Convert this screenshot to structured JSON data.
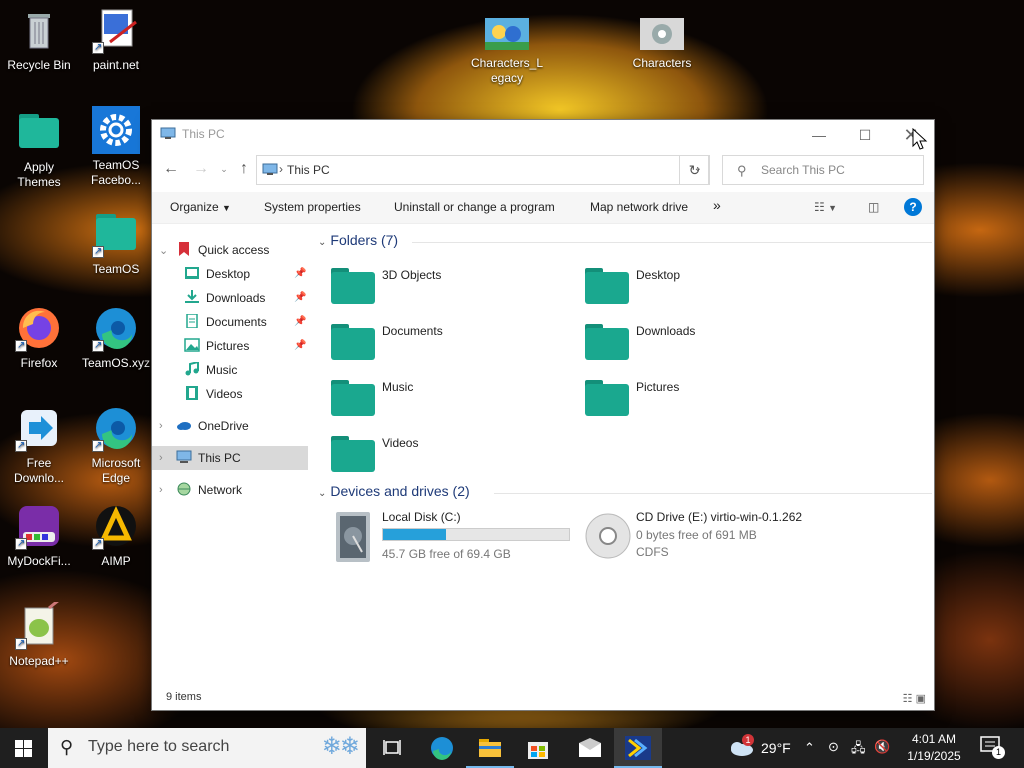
{
  "desktop": {
    "icons": [
      {
        "label": "Recycle Bin",
        "icon": "recycle-bin-icon"
      },
      {
        "label": "paint.net",
        "icon": "paint-net-icon"
      },
      {
        "label": "Apply Themes",
        "icon": "folder-icon"
      },
      {
        "label": "TeamOS Facebo...",
        "icon": "gear-icon"
      },
      {
        "label": "TeamOS",
        "icon": "folder-icon"
      },
      {
        "label": "Firefox",
        "icon": "firefox-icon"
      },
      {
        "label": "TeamOS.xyz",
        "icon": "edge-icon"
      },
      {
        "label": "Free Downlo...",
        "icon": "download-arrow-icon"
      },
      {
        "label": "Microsoft Edge",
        "icon": "edge-icon"
      },
      {
        "label": "MyDockFi...",
        "icon": "dock-icon"
      },
      {
        "label": "AIMP",
        "icon": "aimp-icon"
      },
      {
        "label": "Notepad++",
        "icon": "notepad-plus-plus-icon"
      },
      {
        "label": "Characters_Legacy",
        "icon": "image-icon"
      },
      {
        "label": "Characters",
        "icon": "image-icon"
      }
    ]
  },
  "window": {
    "title": "This PC",
    "address_crumb": "This PC",
    "search_placeholder": "Search This PC",
    "commands": [
      "Organize",
      "System properties",
      "Uninstall or change a program",
      "Map network drive"
    ],
    "more_glyph": "»",
    "nav": {
      "quick_access": "Quick access",
      "quick_items": [
        "Desktop",
        "Downloads",
        "Documents",
        "Pictures",
        "Music",
        "Videos"
      ],
      "onedrive": "OneDrive",
      "this_pc": "This PC",
      "network": "Network"
    },
    "folders_header": "Folders (7)",
    "folders": [
      "3D Objects",
      "Desktop",
      "Documents",
      "Downloads",
      "Music",
      "Pictures",
      "Videos"
    ],
    "drives_header": "Devices and drives (2)",
    "drives": [
      {
        "name": "Local Disk (C:)",
        "free_text": "45.7 GB free of 69.4 GB",
        "used_fraction": 0.34
      },
      {
        "name": "CD Drive (E:) virtio-win-0.1.262",
        "free_text": "0 bytes free of 691 MB",
        "fs": "CDFS"
      }
    ],
    "status_count": "9 items"
  },
  "taskbar": {
    "search_placeholder": "Type here to search",
    "weather": "29°F",
    "time": "4:01 AM",
    "date": "1/19/2025",
    "notification_count": "1",
    "weather_badge": "1"
  },
  "colors": {
    "folder": "#1aa88f",
    "accent": "#0078d7",
    "progress": "#26a0da"
  }
}
